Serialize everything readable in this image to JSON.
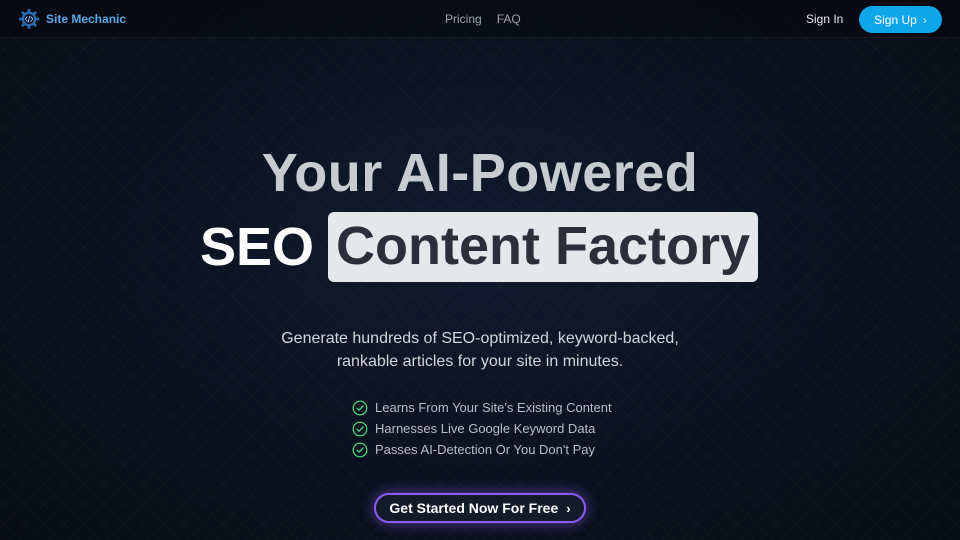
{
  "nav": {
    "brand_name": "Site Mechanic",
    "links": [
      {
        "label": "Pricing"
      },
      {
        "label": "FAQ"
      }
    ],
    "signin_label": "Sign In",
    "signup_label": "Sign Up",
    "signup_chevron": "›"
  },
  "hero": {
    "line1": "Your AI-Powered",
    "line2_plain": "SEO",
    "line2_highlight": "Content Factory",
    "subtitle": "Generate hundreds of SEO-optimized, keyword-backed, rankable articles for your site in minutes."
  },
  "features": [
    {
      "text": "Learns From Your Site's Existing Content",
      "icon": "check-circle-icon"
    },
    {
      "text": "Harnesses Live Google Keyword Data",
      "icon": "check-circle-icon"
    },
    {
      "text": "Passes AI-Detection Or You Don't Pay",
      "icon": "check-circle-icon"
    }
  ],
  "cta": {
    "label": "Get Started Now For Free",
    "chevron": "›"
  },
  "colors": {
    "brand": "#5aa9e6",
    "signup_bg": "#0ea5e9",
    "cta_border": "#8b5cf6",
    "check": "#4ade80"
  }
}
